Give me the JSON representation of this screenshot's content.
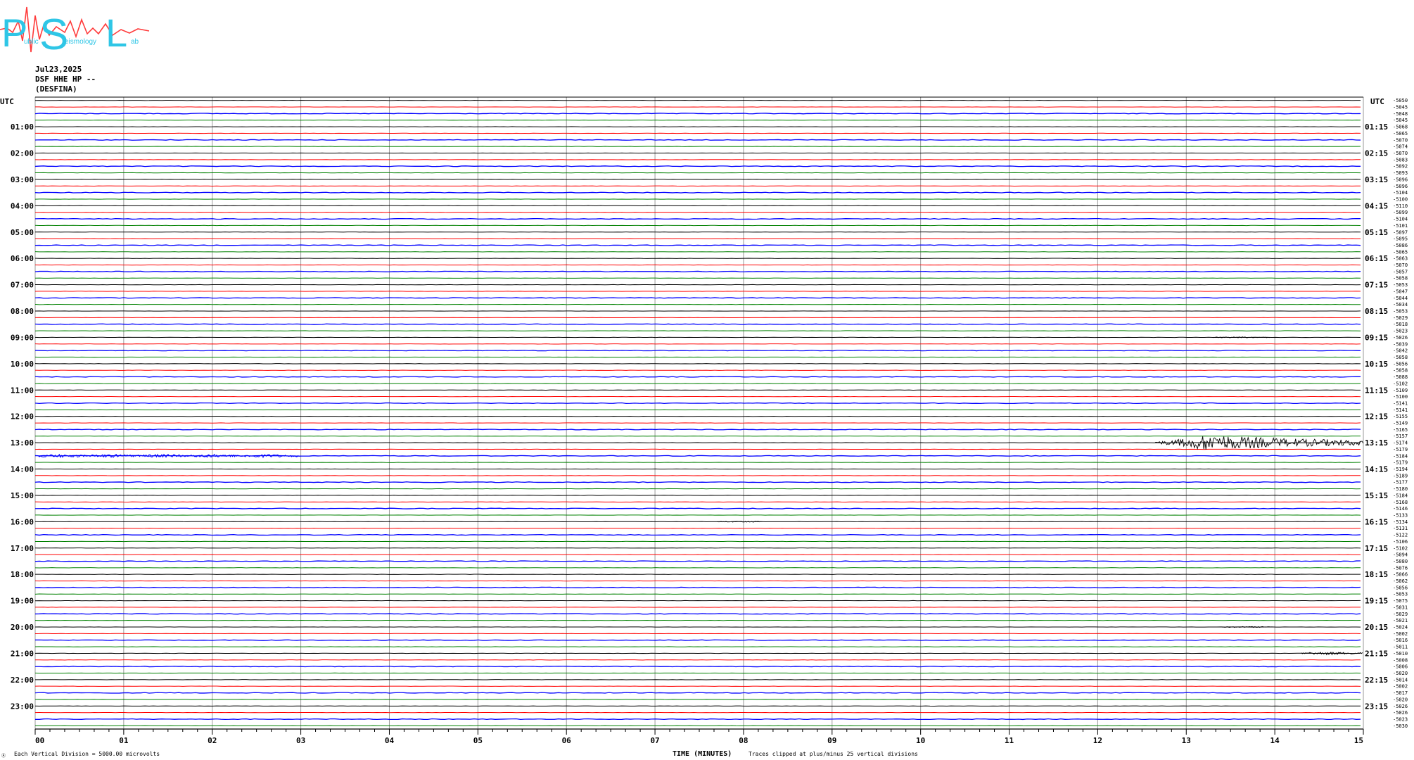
{
  "logo": {
    "letters": [
      "P",
      "S",
      "L"
    ],
    "small_words": [
      "ublic",
      "eismology",
      "ab"
    ],
    "colors": {
      "text": "#2fc6e6",
      "wave": "#ff3b3b"
    }
  },
  "header": {
    "date": "Jul23,2025",
    "station": "DSF HHE HP --",
    "site": "(DESFINA)"
  },
  "footer": {
    "scale_note": "Each Vertical Division = 5000.00 microvolts",
    "xlabel": "TIME (MINUTES)",
    "clip_note": "Traces clipped at plus/minus 25 vertical divisions",
    "corner_mark": "Ⓐ"
  },
  "chart_data": {
    "type": "line",
    "title": "",
    "xlabel": "TIME (MINUTES)",
    "ylabel": "",
    "xlim": [
      0,
      15
    ],
    "x_ticks": [
      "00",
      "01",
      "02",
      "03",
      "04",
      "05",
      "06",
      "07",
      "08",
      "09",
      "10",
      "11",
      "12",
      "13",
      "14",
      "15"
    ],
    "left_axis_title": "UTC",
    "right_axis_title": "UTC",
    "left_hours": [
      "01:00",
      "02:00",
      "03:00",
      "04:00",
      "05:00",
      "06:00",
      "07:00",
      "08:00",
      "09:00",
      "10:00",
      "11:00",
      "12:00",
      "13:00",
      "14:00",
      "15:00",
      "16:00",
      "17:00",
      "18:00",
      "19:00",
      "20:00",
      "21:00",
      "22:00",
      "23:00"
    ],
    "right_hours": [
      "01:15",
      "02:15",
      "03:15",
      "04:15",
      "05:15",
      "06:15",
      "07:15",
      "08:15",
      "09:15",
      "10:15",
      "11:15",
      "12:15",
      "13:15",
      "14:15",
      "15:15",
      "16:15",
      "17:15",
      "18:15",
      "19:15",
      "20:15",
      "21:15",
      "22:15",
      "23:15"
    ],
    "trace_colors": [
      "#000000",
      "#ff0000",
      "#0000ff",
      "#008000"
    ],
    "trace_count": 96,
    "grid": true,
    "offsets": [
      "-5050",
      "-5045",
      "-5048",
      "-5045",
      "-5068",
      "-5065",
      "-5070",
      "-5074",
      "-5070",
      "-5083",
      "-5092",
      "-5093",
      "-5096",
      "-5096",
      "-5104",
      "-5100",
      "-5110",
      "-5099",
      "-5104",
      "-5101",
      "-5097",
      "-5095",
      "-5086",
      "-5065",
      "-5063",
      "-5070",
      "-5057",
      "-5058",
      "-5053",
      "-5047",
      "-5044",
      "-5034",
      "-5053",
      "-5029",
      "-5018",
      "-5023",
      "-5026",
      "-5039",
      "-5042",
      "-5058",
      "-5056",
      "-5058",
      "-5088",
      "-5102",
      "-5109",
      "-5100",
      "-5141",
      "-5141",
      "-5155",
      "-5149",
      "-5165",
      "-5157",
      "-5174",
      "-5179",
      "-5184",
      "-5179",
      "-5194",
      "-5189",
      "-5177",
      "-5180",
      "-5184",
      "-5168",
      "-5146",
      "-5133",
      "-5134",
      "-5131",
      "-5122",
      "-5106",
      "-5102",
      "-5094",
      "-5080",
      "-5076",
      "-5066",
      "-5062",
      "-5056",
      "-5053",
      "-5075",
      "-5031",
      "-5029",
      "-5021",
      "-5024",
      "-5002",
      "-5016",
      "-5011",
      "-5010",
      "-5008",
      "-5006",
      "-5020",
      "-5014",
      "-5002",
      "-5017",
      "-5020",
      "-5026",
      "-5026",
      "-5023",
      "-5030"
    ],
    "events": [
      {
        "trace": 52,
        "start_min": 12.65,
        "end_min": 15.0,
        "peak_min": 13.25,
        "amplitude_div": 1.3
      },
      {
        "trace": 54,
        "start_min": 0.0,
        "end_min": 3.0,
        "amplitude_div": 0.25
      },
      {
        "trace": 36,
        "start_min": 13.3,
        "end_min": 13.95,
        "amplitude_div": 0.08
      },
      {
        "trace": 64,
        "start_min": 7.7,
        "end_min": 8.2,
        "amplitude_div": 0.08
      },
      {
        "trace": 80,
        "start_min": 13.4,
        "end_min": 13.95,
        "amplitude_div": 0.08
      },
      {
        "trace": 84,
        "start_min": 14.3,
        "end_min": 15.0,
        "amplitude_div": 0.22
      }
    ]
  }
}
